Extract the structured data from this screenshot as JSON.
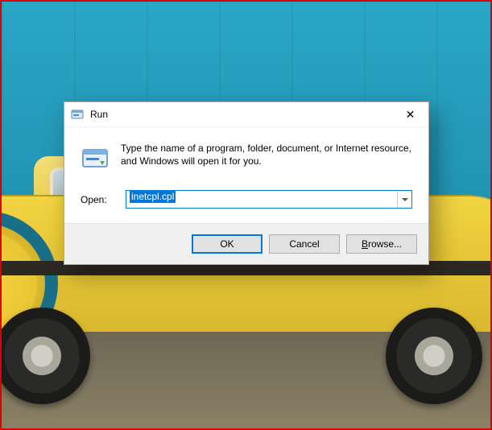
{
  "dialog": {
    "title": "Run",
    "description": "Type the name of a program, folder, document, or Internet resource, and Windows will open it for you.",
    "open_label": "Open:",
    "input_value": "inetcpl.cpl",
    "buttons": {
      "ok": "OK",
      "cancel": "Cancel",
      "browse_prefix": "B",
      "browse_rest": "rowse..."
    }
  },
  "icons": {
    "title_icon": "run-app-icon",
    "body_icon": "run-dialog-icon",
    "close": "close-icon",
    "dropdown": "chevron-down-icon"
  }
}
